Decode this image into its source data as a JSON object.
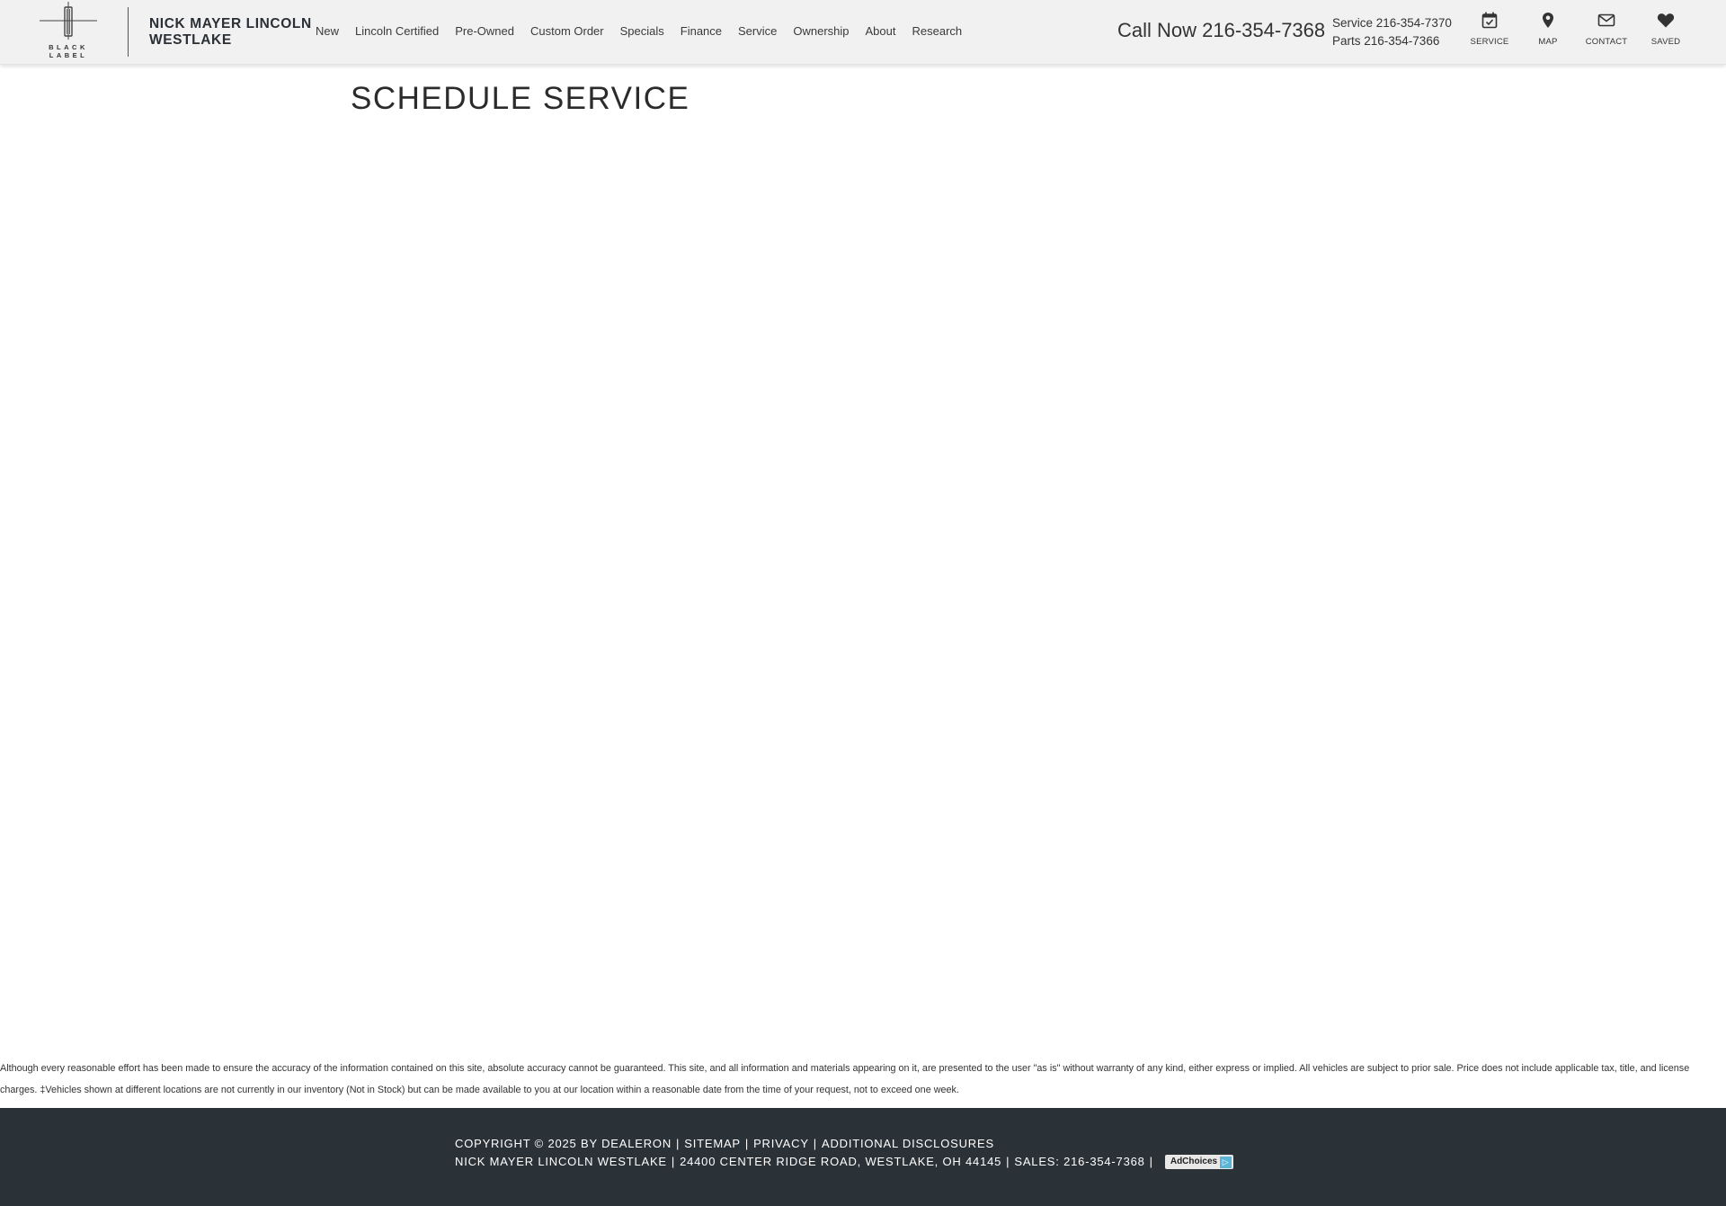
{
  "header": {
    "logo_text": "BLACK LABEL",
    "dealer_name": "NICK MAYER LINCOLN WESTLAKE",
    "nav": [
      "New",
      "Lincoln Certified",
      "Pre-Owned",
      "Custom Order",
      "Specials",
      "Finance",
      "Service",
      "Ownership",
      "About",
      "Research"
    ],
    "call_now": "Call Now 216-354-7368",
    "service_phone": "Service 216-354-7370",
    "parts_phone": "Parts 216-354-7366",
    "utility": {
      "service": {
        "label": "SERVICE",
        "icon": "calendar-check-icon"
      },
      "map": {
        "label": "MAP",
        "icon": "map-marker-icon"
      },
      "contact": {
        "label": "CONTACT",
        "icon": "envelope-icon"
      },
      "saved": {
        "label": "SAVED",
        "icon": "heart-icon"
      }
    }
  },
  "main": {
    "title": "SCHEDULE SERVICE"
  },
  "disclaimer": "Although every reasonable effort has been made to ensure the accuracy of the information contained on this site, absolute accuracy cannot be guaranteed. This site, and all information and materials appearing on it, are presented to the user \"as is\" without warranty of any kind, either express or implied. All vehicles are subject to prior sale. Price does not include applicable tax, title, and license charges. ‡Vehicles shown at different locations are not currently in our inventory (Not in Stock) but can be made available to you at our location within a reasonable date from the time of your request, not to exceed one week.",
  "footer": {
    "copyright": "COPYRIGHT © 2025 BY DEALERON",
    "sitemap": "SITEMAP",
    "privacy": "PRIVACY",
    "additional": "ADDITIONAL DISCLOSURES",
    "separator": "|",
    "dealer": "NICK MAYER LINCOLN WESTLAKE",
    "address": "24400 CENTER RIDGE ROAD, WESTLAKE, OH 44145",
    "sales": "SALES: 216-354-7368",
    "adchoices": "AdChoices"
  },
  "colors": {
    "header_bg": "#f1f1f1",
    "footer_bg": "#2a3137",
    "adchoices_accent": "#5bb5d6"
  }
}
